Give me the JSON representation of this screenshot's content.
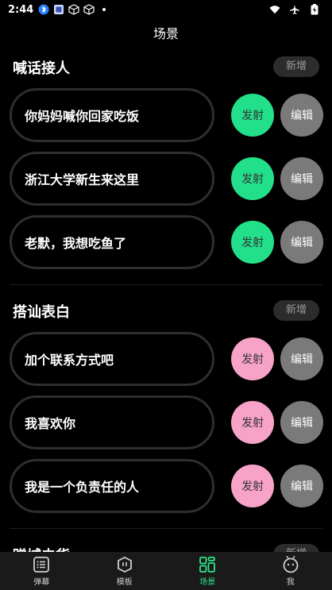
{
  "status": {
    "time": "2:44"
  },
  "header": {
    "title": "场景"
  },
  "colors": {
    "fire_green": "#22e08a",
    "fire_pink": "#f7a3c8",
    "edit_gray": "#7a7a7a",
    "active_tab": "#2fe38c"
  },
  "sections": [
    {
      "title": "喊话接人",
      "add_label": "新增",
      "fire_color": "green",
      "items": [
        {
          "text": "你妈妈喊你回家吃饭",
          "fire": "发射",
          "edit": "编辑"
        },
        {
          "text": "浙江大学新生来这里",
          "fire": "发射",
          "edit": "编辑"
        },
        {
          "text": "老默，我想吃鱼了",
          "fire": "发射",
          "edit": "编辑"
        }
      ]
    },
    {
      "title": "搭讪表白",
      "add_label": "新增",
      "fire_color": "pink",
      "items": [
        {
          "text": "加个联系方式吧",
          "fire": "发射",
          "edit": "编辑"
        },
        {
          "text": "我喜欢你",
          "fire": "发射",
          "edit": "编辑"
        },
        {
          "text": "我是一个负责任的人",
          "fire": "发射",
          "edit": "编辑"
        }
      ]
    },
    {
      "title": "蹭城去货",
      "add_label": "新增"
    }
  ],
  "tabs": [
    {
      "label": "弹幕",
      "icon": "list-icon"
    },
    {
      "label": "模板",
      "icon": "template-icon"
    },
    {
      "label": "场景",
      "icon": "grid-icon"
    },
    {
      "label": "我",
      "icon": "profile-icon"
    }
  ]
}
